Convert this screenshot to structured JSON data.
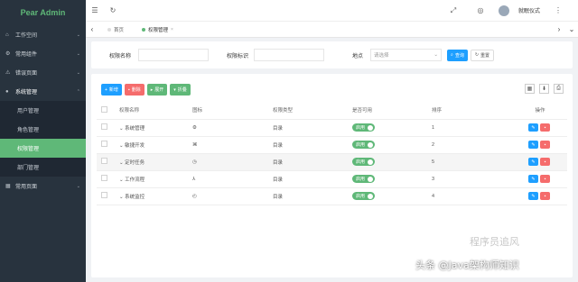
{
  "brand": {
    "title": "Pear Admin"
  },
  "sidebar": {
    "items": [
      {
        "icon": "dashboard-icon",
        "label": "工作空间",
        "glyph": "⌂"
      },
      {
        "icon": "component-icon",
        "label": "常用组件",
        "glyph": "⚙"
      },
      {
        "icon": "error-icon",
        "label": "错误页面",
        "glyph": "⚠"
      },
      {
        "icon": "system-icon",
        "label": "系统管理",
        "glyph": "●"
      }
    ],
    "sub_items": [
      {
        "label": "用户管理"
      },
      {
        "label": "角色管理"
      },
      {
        "label": "权限管理"
      },
      {
        "label": "部门管理"
      }
    ],
    "last_item": {
      "label": "常用页面",
      "glyph": "▦"
    }
  },
  "topbar": {
    "menu_glyph": "☰",
    "refresh_glyph": "↻",
    "fullscreen_glyph": "⤢",
    "globe_glyph": "◎",
    "user_name": "就眠仪式",
    "more_glyph": "⋮"
  },
  "tabs": {
    "home": "首页",
    "active": "权限管理",
    "close_glyph": "×"
  },
  "search": {
    "name_label": "权限名称",
    "code_label": "权限标识",
    "address_label": "地点",
    "address_placeholder": "请选择",
    "query_button": "查询",
    "reset_button": "重置"
  },
  "toolbar": {
    "add": "新增",
    "delete": "删除",
    "expand": "展开",
    "collapse": "折叠"
  },
  "table": {
    "headers": [
      "权限名称",
      "图标",
      "权限类型",
      "是否可用",
      "排序",
      "操作"
    ],
    "rows": [
      {
        "name": "系统管理",
        "icon": "⚙",
        "type": "目录",
        "status": "启用",
        "sort": "1"
      },
      {
        "name": "敏捷开发",
        "icon": "⌘",
        "type": "目录",
        "status": "启用",
        "sort": "2"
      },
      {
        "name": "定时任务",
        "icon": "◷",
        "type": "目录",
        "status": "启用",
        "sort": "5"
      },
      {
        "name": "工作流程",
        "icon": "⅄",
        "type": "目录",
        "status": "启用",
        "sort": "3"
      },
      {
        "name": "系统监控",
        "icon": "◴",
        "type": "目录",
        "status": "启用",
        "sort": "4"
      }
    ]
  },
  "watermark": {
    "text": "头条 @Java架构师知识",
    "logo_text": "程序员追风"
  },
  "colors": {
    "accent": "#5FB878",
    "primary": "#1E9FFF",
    "danger": "#f56c6c",
    "sidebar_bg": "#28333e"
  }
}
